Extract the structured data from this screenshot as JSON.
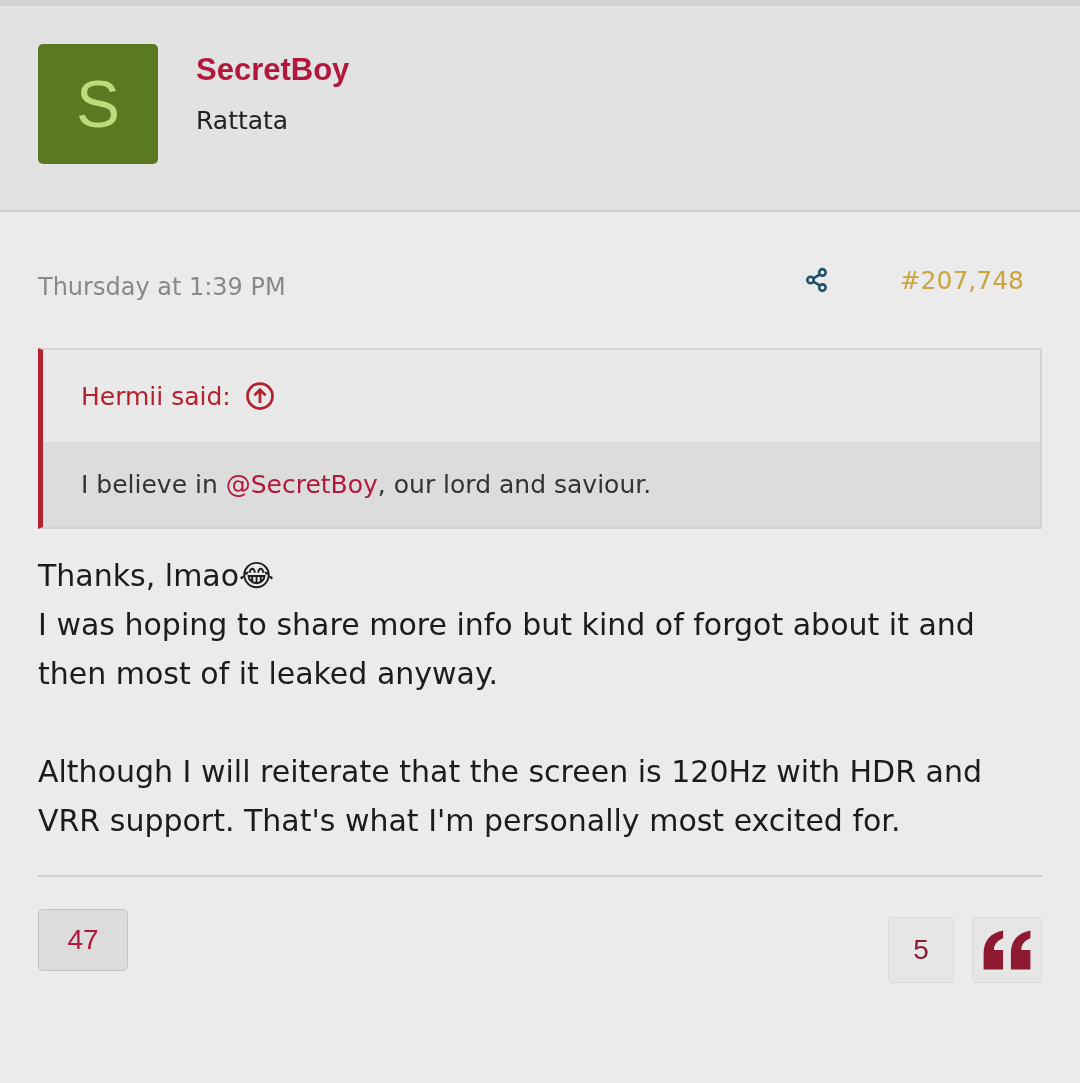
{
  "author": {
    "avatar_letter": "S",
    "name": "SecretBoy",
    "title": "Rattata"
  },
  "post": {
    "date": "Thursday at 1:39 PM",
    "number": "#207,748"
  },
  "quote": {
    "attribution": "Hermii said:",
    "parts": [
      {
        "kind": "text",
        "text": "I believe in "
      },
      {
        "kind": "mention",
        "text": "@SecretBoy"
      },
      {
        "kind": "text",
        "text": ", our lord and saviour."
      }
    ]
  },
  "body": [
    {
      "kind": "text",
      "text": "Thanks, lmao",
      "emoji": "😂"
    },
    {
      "kind": "text",
      "text": "I was hoping to share more info but kind of forgot about it and then most of it leaked anyway."
    },
    {
      "kind": "gap"
    },
    {
      "kind": "text",
      "text": "Although I will reiterate that the screen is 120Hz with HDR and VRR support. That's what I'm personally most excited for."
    }
  ],
  "footer": {
    "reactions": "47",
    "replies": "5"
  }
}
